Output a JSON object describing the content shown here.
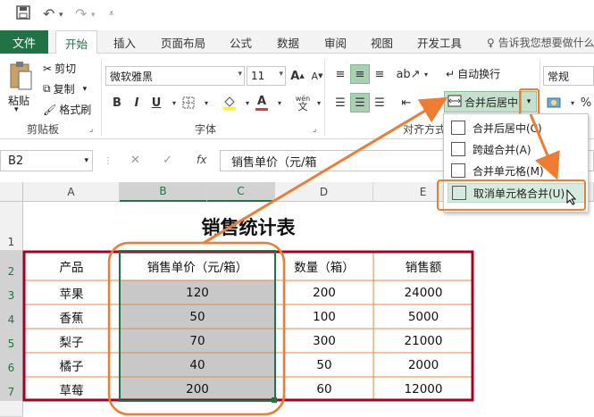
{
  "colors": {
    "accent": "#217346",
    "highlight_orange": "#f07c32",
    "table_border": "#a50021"
  },
  "qat": {
    "save_icon": "save-icon",
    "undo_icon": "undo-icon",
    "redo_icon": "redo-icon"
  },
  "tabs": {
    "file": "文件",
    "home": "开始",
    "insert": "插入",
    "layout": "页面布局",
    "formulas": "公式",
    "data": "数据",
    "review": "审阅",
    "view": "视图",
    "developer": "开发工具",
    "tell_me": "告诉我您想要做什么"
  },
  "ribbon": {
    "clipboard": {
      "paste": "粘贴",
      "cut": "剪切",
      "copy": "复制",
      "format_painter": "格式刷",
      "label": "剪贴板"
    },
    "font": {
      "name": "微软雅黑",
      "size": "11",
      "bold": "B",
      "italic": "I",
      "underline": "U",
      "label": "字体",
      "font_color": "A",
      "wen": "wén",
      "wen2": "文"
    },
    "alignment": {
      "wrap": "自动换行",
      "merge_center": "合并后居中",
      "label": "对齐方式"
    },
    "number": {
      "format": "常规",
      "percent": "%"
    }
  },
  "merge_menu": {
    "items": [
      "合并后居中(C)",
      "跨越合并(A)",
      "合并单元格(M)",
      "取消单元格合并(U)"
    ]
  },
  "formula_bar": {
    "name_box": "B2",
    "cancel": "✕",
    "enter": "✓",
    "fx": "fx",
    "content": "销售单价（元/箱"
  },
  "sheet": {
    "columns": [
      "A",
      "B",
      "C",
      "D",
      "E"
    ],
    "rows": [
      "1",
      "2",
      "3",
      "4",
      "5",
      "6",
      "7"
    ],
    "title": "销售统计表",
    "headers": [
      "产品",
      "销售单价（元/箱）",
      "数量（箱）",
      "销售额"
    ],
    "data": [
      [
        "苹果",
        "120",
        "200",
        "24000"
      ],
      [
        "香蕉",
        "50",
        "100",
        "5000"
      ],
      [
        "梨子",
        "70",
        "300",
        "21000"
      ],
      [
        "橘子",
        "40",
        "50",
        "2000"
      ],
      [
        "草莓",
        "200",
        "60",
        "12000"
      ]
    ]
  }
}
